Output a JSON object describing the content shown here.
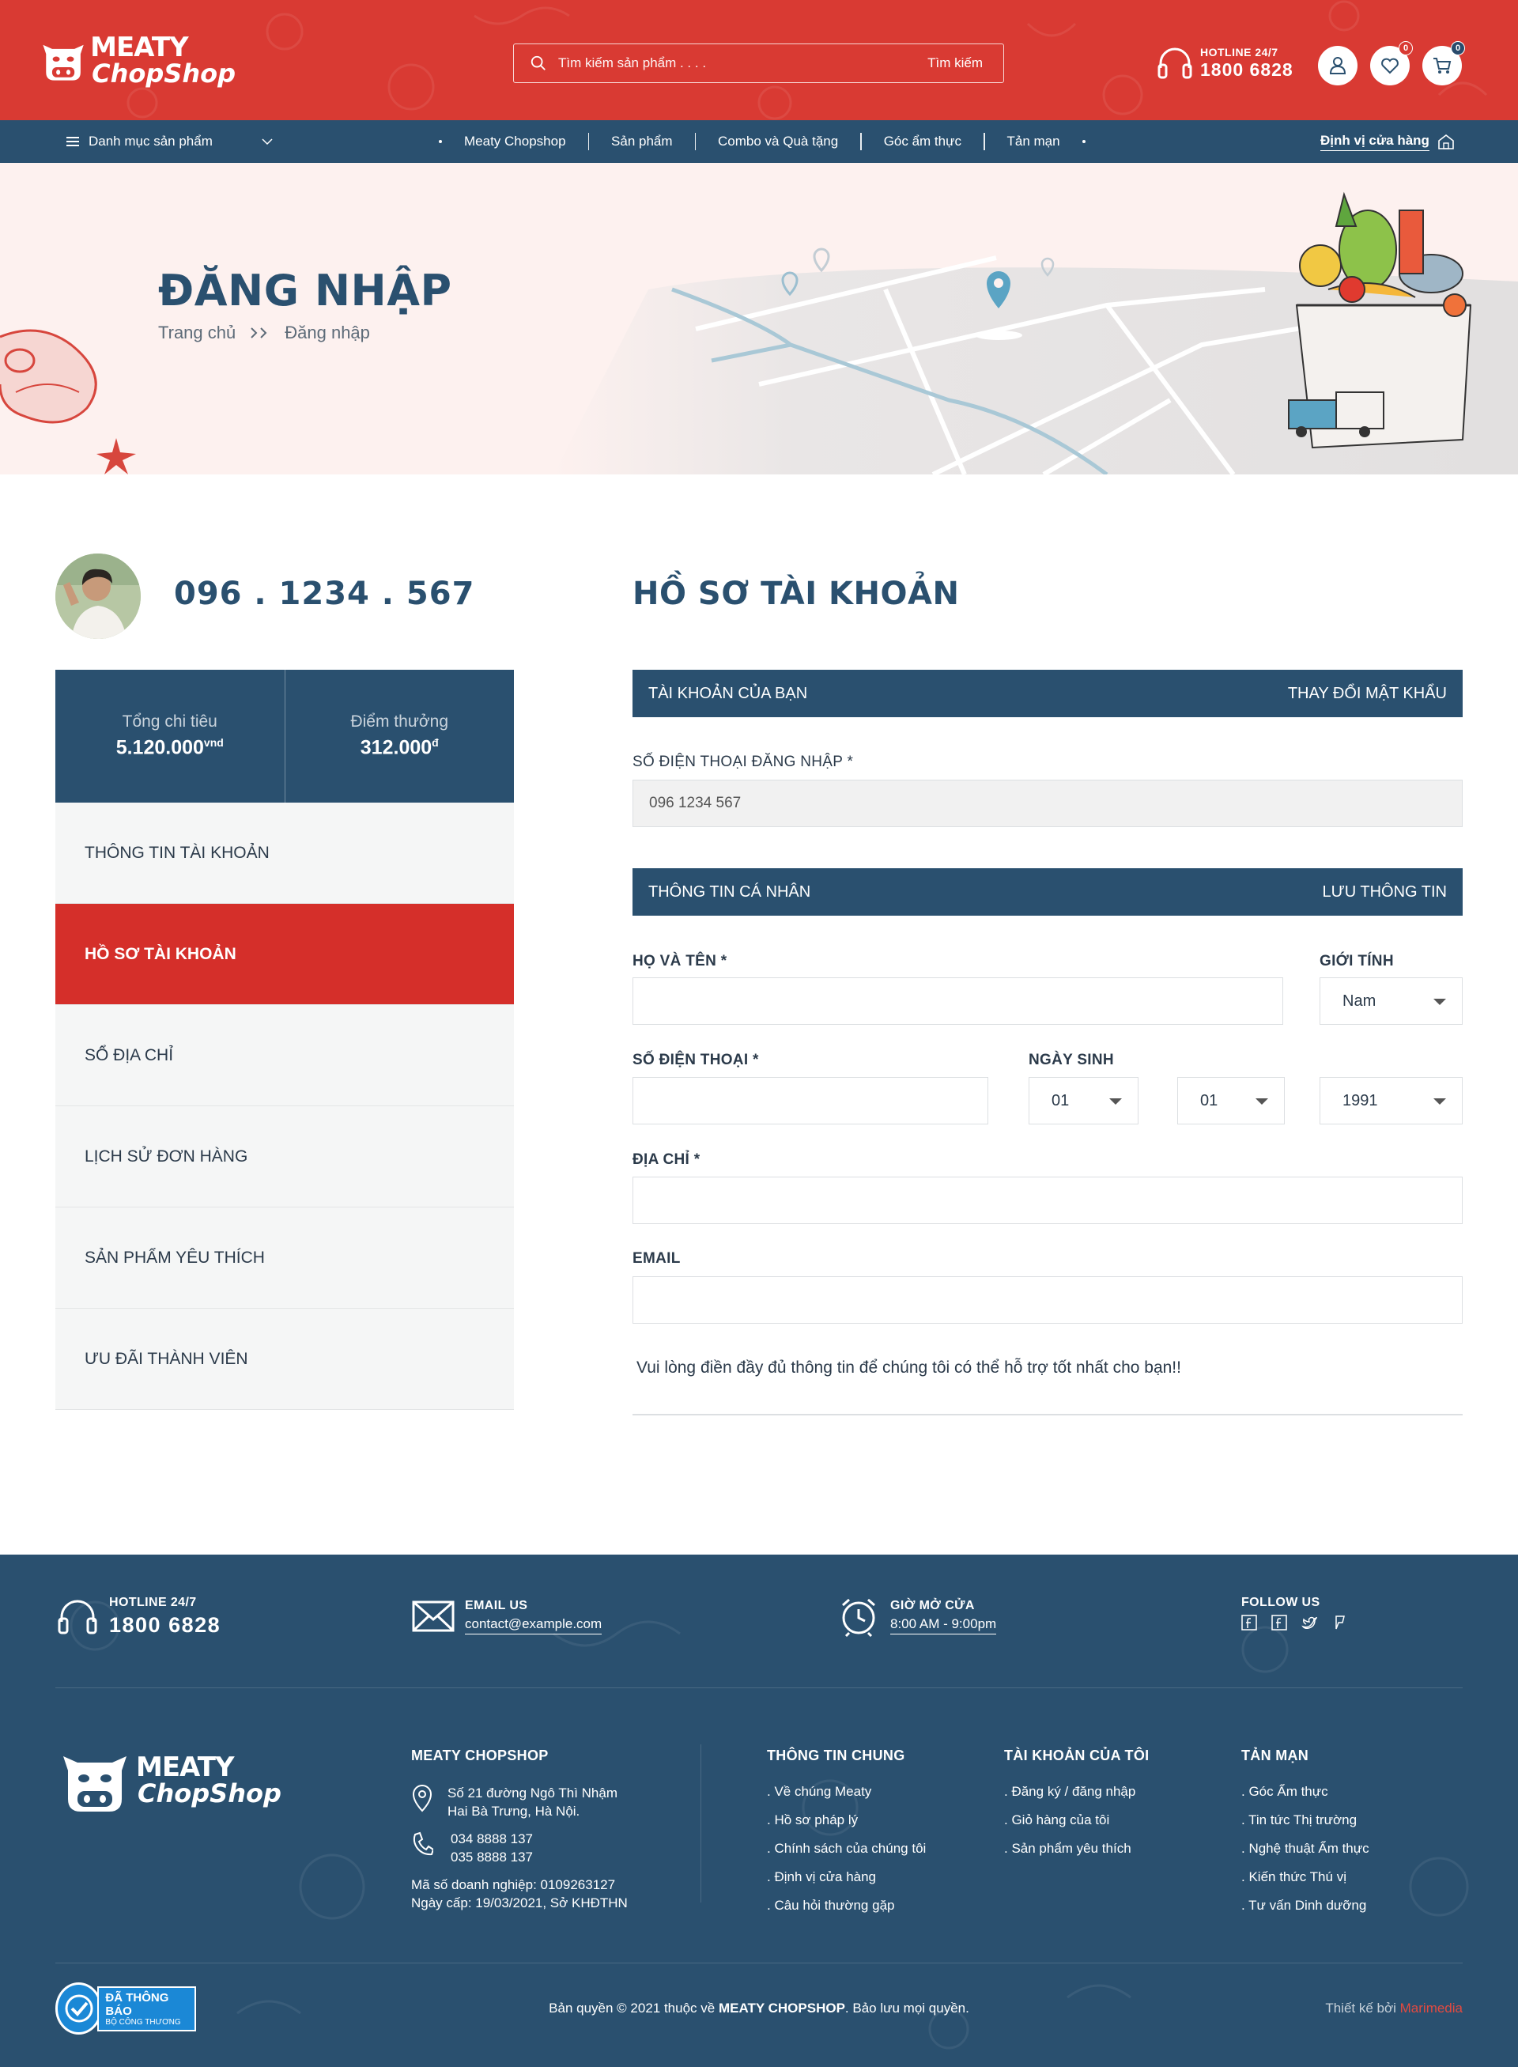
{
  "header": {
    "logo_line1": "MEATY",
    "logo_line2": "ChopShop",
    "search_placeholder": "Tìm kiếm sản phẩm . . . .",
    "search_button": "Tìm kiếm",
    "hotline_label": "HOTLINE 24/7",
    "hotline_number": "1800 6828",
    "wishlist_count": "0",
    "cart_count": "0",
    "brand_color": "#d93a33"
  },
  "nav": {
    "category_label": "Danh mục sản phẩm",
    "items": [
      "Meaty Chopshop",
      "Sản phẩm",
      "Combo và Quà tặng",
      "Góc ẩm thực",
      "Tản mạn"
    ],
    "store_locator": "Định vị cửa hàng",
    "color": "#2a506f"
  },
  "banner": {
    "title": "ĐĂNG NHẬP",
    "breadcrumb_home": "Trang chủ",
    "breadcrumb_current": "Đăng nhập"
  },
  "profile": {
    "phone": "096 . 1234 . 567",
    "spending_label": "Tổng chi tiêu",
    "spending_value": "5.120.000",
    "spending_unit": "vnd",
    "points_label": "Điểm thưởng",
    "points_value": "312.000",
    "points_unit": "đ",
    "menu": [
      "THÔNG TIN TÀI KHOẢN",
      "HỒ SƠ TÀI KHOẢN",
      "SỔ ĐỊA CHỈ",
      "LỊCH SỬ ĐƠN HÀNG",
      "SẢN PHẨM YÊU THÍCH",
      "ƯU ĐÃI THÀNH VIÊN"
    ],
    "active_index": 1
  },
  "form": {
    "title": "HỒ SƠ TÀI KHOẢN",
    "account_bar": "TÀI KHOẢN CỦA BẠN",
    "change_password": "THAY ĐỔI MẬT KHẨU",
    "login_phone_label": "SỐ ĐIỆN THOẠI ĐĂNG NHẬP *",
    "login_phone_value": "096 1234 567",
    "personal_bar": "THÔNG TIN CÁ NHÂN",
    "save_info": "LƯU THÔNG TIN",
    "fullname_label": "HỌ VÀ TÊN *",
    "fullname_value": "",
    "gender_label": "GIỚI TÍNH",
    "gender_value": "Nam",
    "phone_label": "SỐ ĐIỆN THOẠI *",
    "phone_value": "",
    "dob_label": "NGÀY SINH",
    "dob_day": "01",
    "dob_month": "01",
    "dob_year": "1991",
    "address_label": "ĐỊA CHỈ *",
    "address_value": "",
    "email_label": "EMAIL",
    "email_value": "",
    "note": "Vui lòng điền đầy đủ thông tin để chúng tôi có thể hỗ trợ tốt nhất cho bạn!!"
  },
  "footer": {
    "hotline_label": "HOTLINE 24/7",
    "hotline_number": "1800 6828",
    "email_label": "EMAIL US",
    "email_value": "contact@example.com",
    "hours_label": "GIỜ MỞ CỬA",
    "hours_value": "8:00 AM  -  9:00pm",
    "follow_label": "FOLLOW US",
    "company_title": "MEATY CHOPSHOP",
    "address_line1": "Số 21 đường Ngô Thì Nhậm",
    "address_line2": "Hai Bà Trưng, Hà Nội.",
    "phone1": "034 8888 137",
    "phone2": "035 8888 137",
    "biz_line1": "Mã số doanh nghiệp: 0109263127",
    "biz_line2": "Ngày cấp: 19/03/2021, Sở KHĐTHN",
    "col1_title": "THÔNG TIN CHUNG",
    "col1_items": [
      "Về chúng Meaty",
      "Hồ sơ pháp lý",
      "Chính sách của chúng tôi",
      "Định vị cửa hàng",
      "Câu hỏi thường gặp"
    ],
    "col2_title": "TÀI KHOẢN CỦA TÔI",
    "col2_items": [
      "Đăng ký / đăng nhập",
      "Giỏ hàng của tôi",
      "Sản phẩm yêu thích"
    ],
    "col3_title": "TẢN MẠN",
    "col3_items": [
      "Góc Ẩm thực",
      "Tin tức Thị trường",
      "Nghệ thuật Ẩm thực",
      "Kiến thức Thú vị",
      "Tư vấn Dinh dưỡng"
    ],
    "bct_title": "ĐÃ THÔNG BÁO",
    "bct_sub": "BỘ CÔNG THƯƠNG",
    "copyright_prefix": "Bản quyền © 2021 thuộc về",
    "copyright_brand": "MEATY CHOPSHOP",
    "copyright_suffix": ". Bảo lưu mọi quyền.",
    "designer_prefix": "Thiết kế bởi",
    "designer_brand": "Marimedia"
  }
}
